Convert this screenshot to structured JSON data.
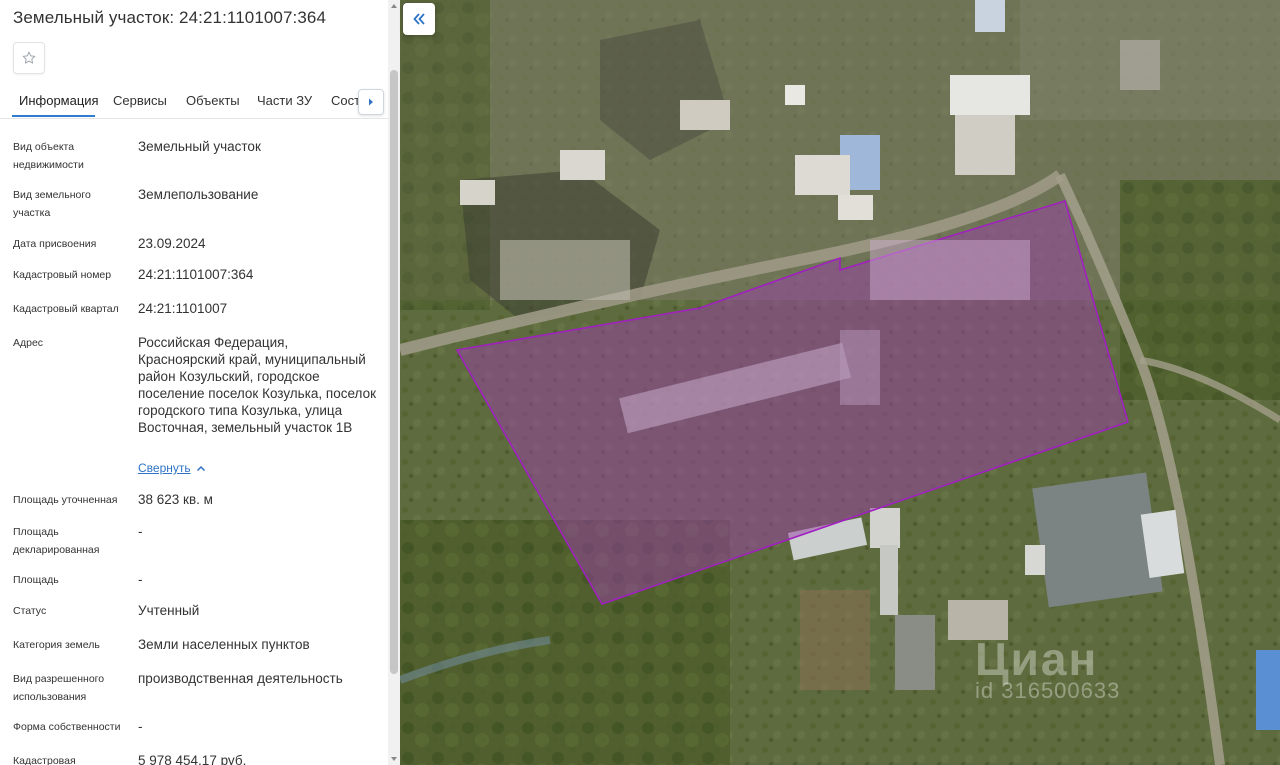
{
  "panel": {
    "title": "Земельный участок: 24:21:1101007:364",
    "tabs": [
      {
        "label": "Информация"
      },
      {
        "label": "Сервисы"
      },
      {
        "label": "Объекты"
      },
      {
        "label": "Части ЗУ"
      },
      {
        "label": "Состав"
      }
    ],
    "rows": [
      {
        "label": "Вид объекта недвижимости",
        "value": "Земельный участок"
      },
      {
        "label": "Вид земельного участка",
        "value": "Землепользование"
      },
      {
        "label": "Дата присвоения",
        "value": "23.09.2024"
      },
      {
        "label": "Кадастровый номер",
        "value": "24:21:1101007:364"
      },
      {
        "label": "Кадастровый квартал",
        "value": "24:21:1101007"
      },
      {
        "label": "Адрес",
        "value": "Российская Федерация, Красноярский край, муниципальный район Козульский, городское поселение поселок Козулька, поселок городского типа Козулька, улица Восточная, земельный участок 1В"
      },
      {
        "label": "Площадь уточненная",
        "value": "38 623 кв. м"
      },
      {
        "label": "Площадь декларированная",
        "value": "-"
      },
      {
        "label": "Площадь",
        "value": "-"
      },
      {
        "label": "Статус",
        "value": "Учтенный"
      },
      {
        "label": "Категория земель",
        "value": "Земли населенных пунктов"
      },
      {
        "label": "Вид разрешенного использования",
        "value": "производственная деятельность"
      },
      {
        "label": "Форма собственности",
        "value": "-"
      },
      {
        "label": "Кадастровая",
        "value": "5 978 454,17 руб."
      }
    ],
    "collapse_label": "Свернуть"
  },
  "map": {
    "watermark": "Циан",
    "watermark_id": "id 316500633",
    "parcel_color": "#a020c0"
  },
  "icons": {
    "favorite": "star-outline-icon",
    "tabs_next": "chevron-right-icon",
    "collapse_panel": "double-chevron-left-icon",
    "collapse_address": "chevron-up-icon"
  }
}
